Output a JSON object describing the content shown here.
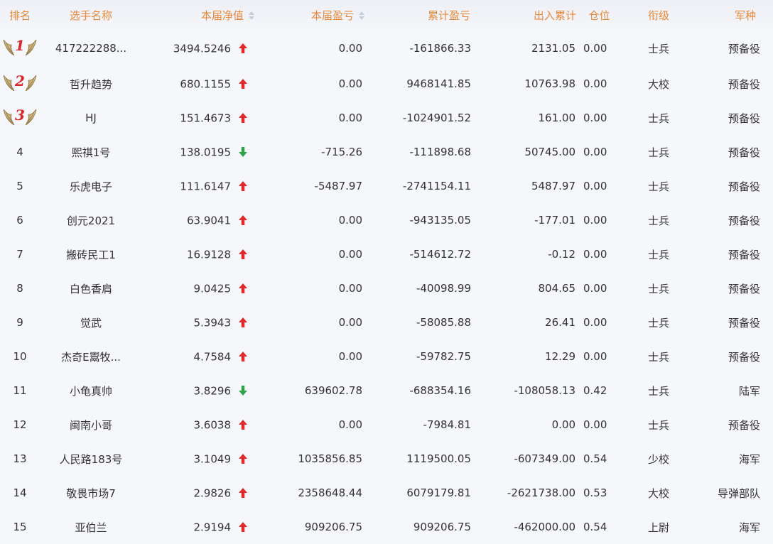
{
  "headers": {
    "rank": "排名",
    "name": "选手名称",
    "nav": "本届净值",
    "current_pl": "本届盈亏",
    "cumulative_pl": "累计盈亏",
    "flow": "出入累计",
    "position": "仓位",
    "level": "衔级",
    "army": "军种"
  },
  "icons": {
    "sort": "sort-updown-icon",
    "up": "arrow-up-icon",
    "down": "arrow-down-icon",
    "medal": "wing-medal-icon"
  },
  "colors": {
    "header_text": "#e8883a",
    "up": "#e02a2a",
    "down": "#2fa34a",
    "medal_number": "#d9242a"
  },
  "rows": [
    {
      "rank": "1",
      "name": "417222288...",
      "nav": "3494.5246",
      "trend": "up",
      "current_pl": "0.00",
      "cumulative_pl": "-161866.33",
      "flow": "2131.05",
      "position": "0.00",
      "level": "士兵",
      "army": "预备役"
    },
    {
      "rank": "2",
      "name": "哲升趋势",
      "nav": "680.1155",
      "trend": "up",
      "current_pl": "0.00",
      "cumulative_pl": "9468141.85",
      "flow": "10763.98",
      "position": "0.00",
      "level": "大校",
      "army": "预备役"
    },
    {
      "rank": "3",
      "name": "HJ",
      "nav": "151.4673",
      "trend": "up",
      "current_pl": "0.00",
      "cumulative_pl": "-1024901.52",
      "flow": "161.00",
      "position": "0.00",
      "level": "士兵",
      "army": "预备役"
    },
    {
      "rank": "4",
      "name": "熙祺1号",
      "nav": "138.0195",
      "trend": "down",
      "current_pl": "-715.26",
      "cumulative_pl": "-111898.68",
      "flow": "50745.00",
      "position": "0.00",
      "level": "士兵",
      "army": "预备役"
    },
    {
      "rank": "5",
      "name": "乐虎电子",
      "nav": "111.6147",
      "trend": "up",
      "current_pl": "-5487.97",
      "cumulative_pl": "-2741154.11",
      "flow": "5487.97",
      "position": "0.00",
      "level": "士兵",
      "army": "预备役"
    },
    {
      "rank": "6",
      "name": "创元2021",
      "nav": "63.9041",
      "trend": "up",
      "current_pl": "0.00",
      "cumulative_pl": "-943135.05",
      "flow": "-177.01",
      "position": "0.00",
      "level": "士兵",
      "army": "预备役"
    },
    {
      "rank": "7",
      "name": "搬砖民工1",
      "nav": "16.9128",
      "trend": "up",
      "current_pl": "0.00",
      "cumulative_pl": "-514612.72",
      "flow": "-0.12",
      "position": "0.00",
      "level": "士兵",
      "army": "预备役"
    },
    {
      "rank": "8",
      "name": "白色香肩",
      "nav": "9.0425",
      "trend": "up",
      "current_pl": "0.00",
      "cumulative_pl": "-40098.99",
      "flow": "804.65",
      "position": "0.00",
      "level": "士兵",
      "army": "预备役"
    },
    {
      "rank": "9",
      "name": "觉武",
      "nav": "5.3943",
      "trend": "up",
      "current_pl": "0.00",
      "cumulative_pl": "-58085.88",
      "flow": "26.41",
      "position": "0.00",
      "level": "士兵",
      "army": "预备役"
    },
    {
      "rank": "10",
      "name": "杰奇E鬻牧...",
      "nav": "4.7584",
      "trend": "up",
      "current_pl": "0.00",
      "cumulative_pl": "-59782.75",
      "flow": "12.29",
      "position": "0.00",
      "level": "士兵",
      "army": "预备役"
    },
    {
      "rank": "11",
      "name": "小龟真帅",
      "nav": "3.8296",
      "trend": "down",
      "current_pl": "639602.78",
      "cumulative_pl": "-688354.16",
      "flow": "-108058.13",
      "position": "0.42",
      "level": "士兵",
      "army": "陆军"
    },
    {
      "rank": "12",
      "name": "闽南小哥",
      "nav": "3.6038",
      "trend": "up",
      "current_pl": "0.00",
      "cumulative_pl": "-7984.81",
      "flow": "0.00",
      "position": "0.00",
      "level": "士兵",
      "army": "预备役"
    },
    {
      "rank": "13",
      "name": "人民路183号",
      "nav": "3.1049",
      "trend": "up",
      "current_pl": "1035856.85",
      "cumulative_pl": "1119500.05",
      "flow": "-607349.00",
      "position": "0.54",
      "level": "少校",
      "army": "海军"
    },
    {
      "rank": "14",
      "name": "敬畏市场7",
      "nav": "2.9826",
      "trend": "up",
      "current_pl": "2358648.44",
      "cumulative_pl": "6079179.81",
      "flow": "-2621738.00",
      "position": "0.53",
      "level": "大校",
      "army": "导弹部队"
    },
    {
      "rank": "15",
      "name": "亚伯兰",
      "nav": "2.9194",
      "trend": "up",
      "current_pl": "909206.75",
      "cumulative_pl": "909206.75",
      "flow": "-462000.00",
      "position": "0.54",
      "level": "上尉",
      "army": "海军"
    }
  ]
}
